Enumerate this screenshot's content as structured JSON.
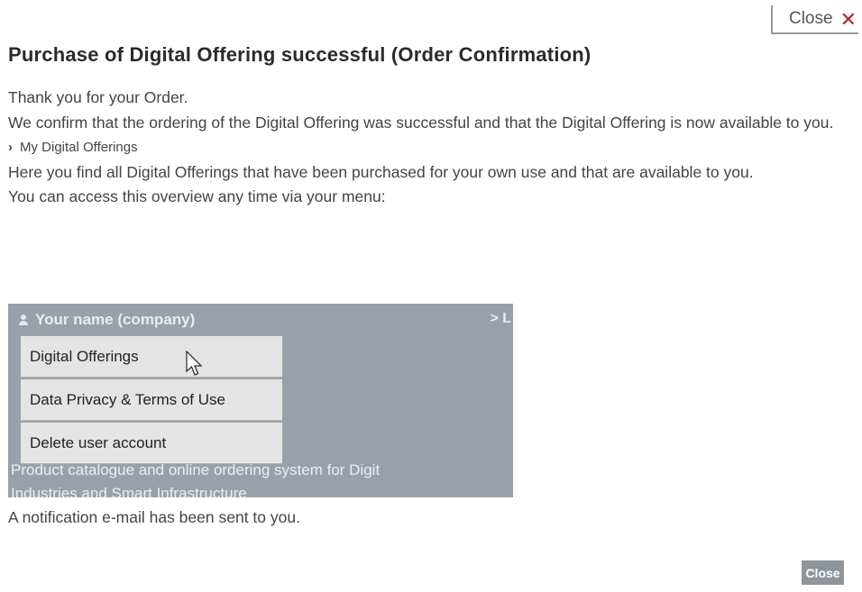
{
  "dialog": {
    "top_close_label": "Close",
    "title": "Purchase of Digital Offering successful (Order Confirmation)",
    "thank_you": "Thank you for your Order.",
    "confirm_text": "We confirm that the ordering of the Digital Offering was successful and that the Digital Offering is now available to you.",
    "link_label": "My Digital Offerings",
    "find_text": "Here you find all Digital Offerings that have been purchased for your own use and that are available to you.",
    "access_text": "You can access this overview any time via your menu:",
    "notification_text": "A notification e-mail has been sent to you.",
    "bottom_close_label": "Close"
  },
  "menu_preview": {
    "user_label": "Your name (company)",
    "right_label": "> L",
    "items": [
      {
        "label": "Digital Offerings"
      },
      {
        "label": "Data Privacy & Terms of Use"
      },
      {
        "label": "Delete user account"
      }
    ],
    "footer_line1": "Product catalogue and online ordering system for Digit",
    "footer_line2": "Industries and Smart Infrastructure"
  },
  "colors": {
    "accent_close": "#b0252a",
    "menu_background": "#9aa0ab",
    "button_background": "#8e959e"
  }
}
